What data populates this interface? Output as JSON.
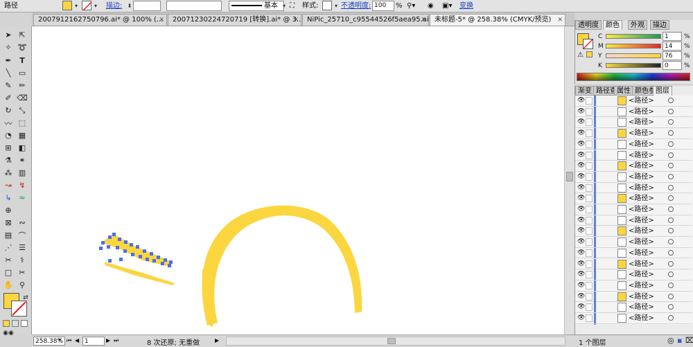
{
  "control_bar": {
    "selection_label": "路径",
    "stroke_label": "描边:",
    "stroke_weight_value": "",
    "brush_value": "",
    "profile_label": "基本",
    "style_label": "样式:",
    "opacity_label": "不透明度:",
    "opacity_value": "100",
    "opacity_unit": "%",
    "transform_label": "变换"
  },
  "tabs": [
    {
      "label": "2007912162750796.ai* @ 100% (..."
    },
    {
      "label": "20071230224720719 [转换].ai* @ 3..."
    },
    {
      "label": "NiPic_25710_c95544526f5aea95.ai*"
    },
    {
      "label": "未标题-5* @ 258.38% (CMYK/预览)"
    }
  ],
  "color_panel": {
    "tabs": [
      "透明度",
      "颜色",
      "外观",
      "描边"
    ],
    "active_tab": "颜色",
    "channels": [
      {
        "name": "C",
        "value": "1",
        "unit": "%"
      },
      {
        "name": "M",
        "value": "14",
        "unit": "%"
      },
      {
        "name": "Y",
        "value": "76",
        "unit": "%"
      },
      {
        "name": "K",
        "value": "0",
        "unit": "%"
      }
    ],
    "fill_color": "#fbd63f"
  },
  "layers_panel": {
    "tabs": [
      "渐变",
      "路径查",
      "属性",
      "颜色参",
      "图层"
    ],
    "active_tab": "图层",
    "row_label": "<路径>",
    "row_count": 22,
    "footer_text": "1 个图层"
  },
  "status_bar": {
    "zoom": "258.38%",
    "page": "1",
    "message": "8 次还原; 无重做"
  },
  "colors": {
    "artwork": "#fbd63f",
    "selection": "#4a6ff0"
  }
}
